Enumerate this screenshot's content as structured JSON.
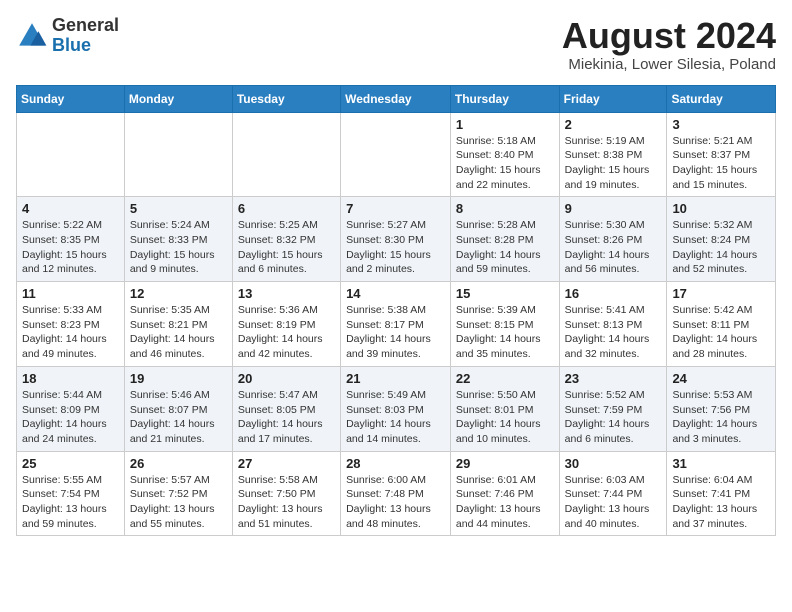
{
  "header": {
    "logo_general": "General",
    "logo_blue": "Blue",
    "month_year": "August 2024",
    "location": "Miekinia, Lower Silesia, Poland"
  },
  "weekdays": [
    "Sunday",
    "Monday",
    "Tuesday",
    "Wednesday",
    "Thursday",
    "Friday",
    "Saturday"
  ],
  "weeks": [
    [
      {
        "day": "",
        "info": ""
      },
      {
        "day": "",
        "info": ""
      },
      {
        "day": "",
        "info": ""
      },
      {
        "day": "",
        "info": ""
      },
      {
        "day": "1",
        "info": "Sunrise: 5:18 AM\nSunset: 8:40 PM\nDaylight: 15 hours\nand 22 minutes."
      },
      {
        "day": "2",
        "info": "Sunrise: 5:19 AM\nSunset: 8:38 PM\nDaylight: 15 hours\nand 19 minutes."
      },
      {
        "day": "3",
        "info": "Sunrise: 5:21 AM\nSunset: 8:37 PM\nDaylight: 15 hours\nand 15 minutes."
      }
    ],
    [
      {
        "day": "4",
        "info": "Sunrise: 5:22 AM\nSunset: 8:35 PM\nDaylight: 15 hours\nand 12 minutes."
      },
      {
        "day": "5",
        "info": "Sunrise: 5:24 AM\nSunset: 8:33 PM\nDaylight: 15 hours\nand 9 minutes."
      },
      {
        "day": "6",
        "info": "Sunrise: 5:25 AM\nSunset: 8:32 PM\nDaylight: 15 hours\nand 6 minutes."
      },
      {
        "day": "7",
        "info": "Sunrise: 5:27 AM\nSunset: 8:30 PM\nDaylight: 15 hours\nand 2 minutes."
      },
      {
        "day": "8",
        "info": "Sunrise: 5:28 AM\nSunset: 8:28 PM\nDaylight: 14 hours\nand 59 minutes."
      },
      {
        "day": "9",
        "info": "Sunrise: 5:30 AM\nSunset: 8:26 PM\nDaylight: 14 hours\nand 56 minutes."
      },
      {
        "day": "10",
        "info": "Sunrise: 5:32 AM\nSunset: 8:24 PM\nDaylight: 14 hours\nand 52 minutes."
      }
    ],
    [
      {
        "day": "11",
        "info": "Sunrise: 5:33 AM\nSunset: 8:23 PM\nDaylight: 14 hours\nand 49 minutes."
      },
      {
        "day": "12",
        "info": "Sunrise: 5:35 AM\nSunset: 8:21 PM\nDaylight: 14 hours\nand 46 minutes."
      },
      {
        "day": "13",
        "info": "Sunrise: 5:36 AM\nSunset: 8:19 PM\nDaylight: 14 hours\nand 42 minutes."
      },
      {
        "day": "14",
        "info": "Sunrise: 5:38 AM\nSunset: 8:17 PM\nDaylight: 14 hours\nand 39 minutes."
      },
      {
        "day": "15",
        "info": "Sunrise: 5:39 AM\nSunset: 8:15 PM\nDaylight: 14 hours\nand 35 minutes."
      },
      {
        "day": "16",
        "info": "Sunrise: 5:41 AM\nSunset: 8:13 PM\nDaylight: 14 hours\nand 32 minutes."
      },
      {
        "day": "17",
        "info": "Sunrise: 5:42 AM\nSunset: 8:11 PM\nDaylight: 14 hours\nand 28 minutes."
      }
    ],
    [
      {
        "day": "18",
        "info": "Sunrise: 5:44 AM\nSunset: 8:09 PM\nDaylight: 14 hours\nand 24 minutes."
      },
      {
        "day": "19",
        "info": "Sunrise: 5:46 AM\nSunset: 8:07 PM\nDaylight: 14 hours\nand 21 minutes."
      },
      {
        "day": "20",
        "info": "Sunrise: 5:47 AM\nSunset: 8:05 PM\nDaylight: 14 hours\nand 17 minutes."
      },
      {
        "day": "21",
        "info": "Sunrise: 5:49 AM\nSunset: 8:03 PM\nDaylight: 14 hours\nand 14 minutes."
      },
      {
        "day": "22",
        "info": "Sunrise: 5:50 AM\nSunset: 8:01 PM\nDaylight: 14 hours\nand 10 minutes."
      },
      {
        "day": "23",
        "info": "Sunrise: 5:52 AM\nSunset: 7:59 PM\nDaylight: 14 hours\nand 6 minutes."
      },
      {
        "day": "24",
        "info": "Sunrise: 5:53 AM\nSunset: 7:56 PM\nDaylight: 14 hours\nand 3 minutes."
      }
    ],
    [
      {
        "day": "25",
        "info": "Sunrise: 5:55 AM\nSunset: 7:54 PM\nDaylight: 13 hours\nand 59 minutes."
      },
      {
        "day": "26",
        "info": "Sunrise: 5:57 AM\nSunset: 7:52 PM\nDaylight: 13 hours\nand 55 minutes."
      },
      {
        "day": "27",
        "info": "Sunrise: 5:58 AM\nSunset: 7:50 PM\nDaylight: 13 hours\nand 51 minutes."
      },
      {
        "day": "28",
        "info": "Sunrise: 6:00 AM\nSunset: 7:48 PM\nDaylight: 13 hours\nand 48 minutes."
      },
      {
        "day": "29",
        "info": "Sunrise: 6:01 AM\nSunset: 7:46 PM\nDaylight: 13 hours\nand 44 minutes."
      },
      {
        "day": "30",
        "info": "Sunrise: 6:03 AM\nSunset: 7:44 PM\nDaylight: 13 hours\nand 40 minutes."
      },
      {
        "day": "31",
        "info": "Sunrise: 6:04 AM\nSunset: 7:41 PM\nDaylight: 13 hours\nand 37 minutes."
      }
    ]
  ]
}
